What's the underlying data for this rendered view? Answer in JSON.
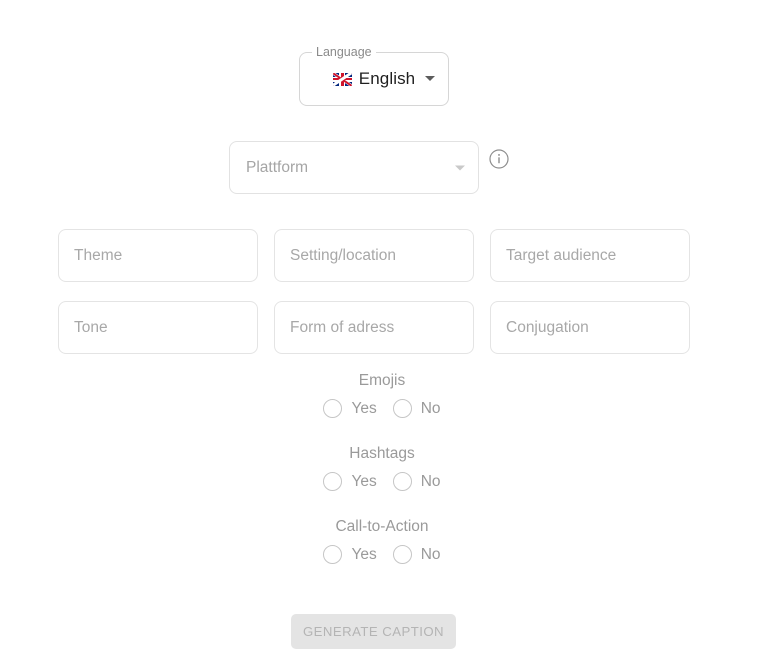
{
  "language_select": {
    "label": "Language",
    "value": "English",
    "flag_icon": "uk-flag-icon",
    "caret_icon": "chevron-down-icon"
  },
  "platform_select": {
    "placeholder": "Plattform",
    "caret_icon": "chevron-down-icon",
    "info_icon": "info-circle-icon"
  },
  "fields": [
    {
      "name": "theme",
      "placeholder": "Theme"
    },
    {
      "name": "setting",
      "placeholder": "Setting/location"
    },
    {
      "name": "target-audience",
      "placeholder": "Target audience"
    },
    {
      "name": "tone",
      "placeholder": "Tone"
    },
    {
      "name": "form-of-adress",
      "placeholder": "Form of adress"
    },
    {
      "name": "conjugation",
      "placeholder": "Conjugation"
    }
  ],
  "radio_groups": [
    {
      "title": "Emojis",
      "yes": "Yes",
      "no": "No",
      "selected": null
    },
    {
      "title": "Hashtags",
      "yes": "Yes",
      "no": "No",
      "selected": null
    },
    {
      "title": "Call-to-Action",
      "yes": "Yes",
      "no": "No",
      "selected": null
    }
  ],
  "submit": {
    "label": "GENERATE CAPTION",
    "disabled": true
  },
  "colors": {
    "background": "#ffffff",
    "border": "#e4e4e4",
    "placeholder_text": "#a8a8a8",
    "value_text": "#1f1f1f",
    "button_bg": "#e4e4e4",
    "button_text": "#b4b4b4"
  }
}
